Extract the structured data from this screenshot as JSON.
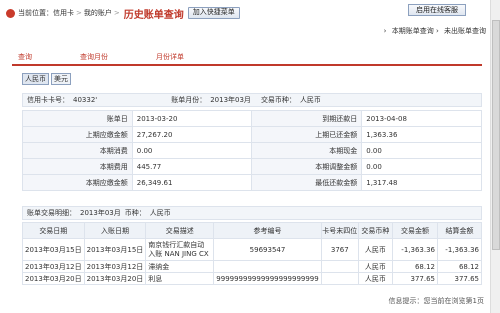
{
  "breadcrumb": {
    "prefix": "当前位置：",
    "items": [
      "信用卡",
      "我的账户"
    ],
    "separator": ">",
    "current": "历史账单查询"
  },
  "buttons": {
    "shortcut": "加入快捷菜单",
    "online_service": "启用在线客服"
  },
  "toplinks": [
    "本期账单查询",
    "未出账单查询"
  ],
  "tabs": [
    "查询",
    "查询月份",
    "月份详单"
  ],
  "currency": {
    "active": "人民币",
    "other": "美元"
  },
  "info": {
    "card_label": "信用卡卡号：",
    "card_no": "40332'",
    "month_label": "账单月份：",
    "month": "2013年03月",
    "currency_label": "交易币种：",
    "currency": "人民币"
  },
  "summary": [
    {
      "l1": "账单日",
      "v1": "2013-03-20",
      "l2": "到期还款日",
      "v2": "2013-04-08"
    },
    {
      "l1": "上期应缴金额",
      "v1": "27,267.20",
      "l2": "上期已还金额",
      "v2": "1,363.36"
    },
    {
      "l1": "本期消费",
      "v1": "0.00",
      "l2": "本期现金",
      "v2": "0.00"
    },
    {
      "l1": "本期费用",
      "v1": "445.77",
      "l2": "本期调整金额",
      "v2": "0.00"
    },
    {
      "l1": "本期应缴金额",
      "v1": "26,349.61",
      "l2": "最低还款金额",
      "v2": "1,317.48"
    }
  ],
  "detail_head": {
    "label": "账单交易明细：",
    "month": "2013年03月",
    "currency_label": "币种：",
    "currency": "人民币"
  },
  "columns": [
    "交易日期",
    "入账日期",
    "交易描述",
    "参考编号",
    "卡号末四位",
    "交易币种",
    "交易金额",
    "结算金额"
  ],
  "rows": [
    {
      "date": "2013年03月15日",
      "post": "2013年03月15日",
      "desc": "南京钱行汇款自动",
      "desc2": "入账 NAN JING CX",
      "ref": "59693547",
      "last4": "3767",
      "cur": "人民币",
      "amt": "-1,363.36",
      "settle": "-1,363.36"
    },
    {
      "date": "2013年03月12日",
      "post": "2013年03月12日",
      "desc": "滞纳金",
      "desc2": "",
      "ref": "",
      "last4": "",
      "cur": "人民币",
      "amt": "68.12",
      "settle": "68.12"
    },
    {
      "date": "2013年03月20日",
      "post": "2013年03月20日",
      "desc": "利息",
      "desc2": "",
      "ref": "99999999999999999999999",
      "last4": "",
      "cur": "人民币",
      "amt": "377.65",
      "settle": "377.65"
    }
  ],
  "footer": "信息提示：您当前在浏览第1页"
}
